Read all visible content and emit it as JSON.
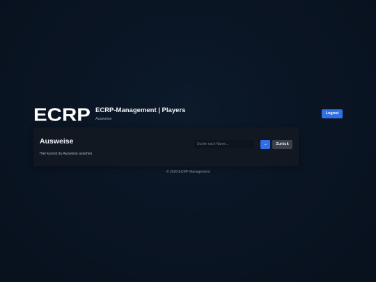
{
  "header": {
    "logo_text": "ECRP",
    "title": "ECRP-Management | Players",
    "subtitle": "Ausweise",
    "logout_label": "Logout"
  },
  "card": {
    "title": "Ausweise",
    "description": "Hier kannst du Ausweise ansehen.",
    "search": {
      "placeholder": "Suche nach Name...",
      "value": ""
    },
    "search_button_label": "→",
    "back_button_label": "Zurück"
  },
  "footer": {
    "text": "© 2026 ECRP-Management"
  },
  "colors": {
    "background": "#0a1524",
    "card": "#111821",
    "accent": "#2f6fe8",
    "secondary_button": "#3a4049"
  }
}
